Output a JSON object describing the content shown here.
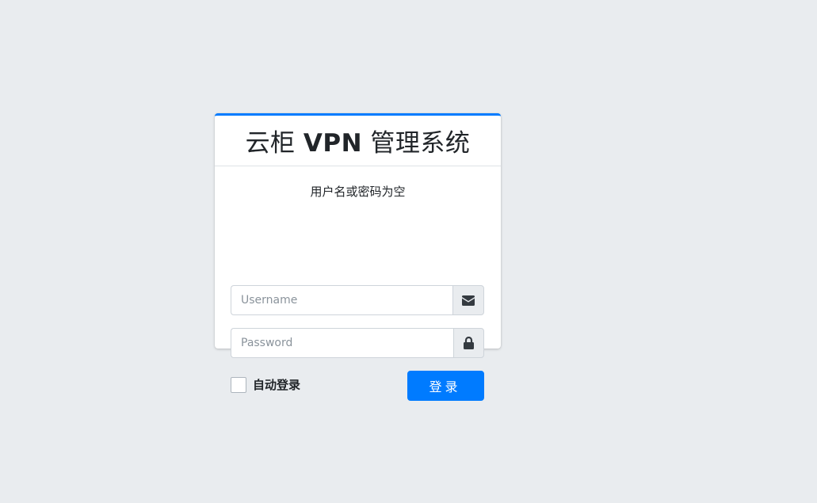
{
  "header": {
    "brand_prefix": "云柜 ",
    "brand_bold": "VPN",
    "brand_suffix": " 管理系统"
  },
  "body": {
    "message": "用户名或密码为空"
  },
  "form": {
    "username_placeholder": "Username",
    "username_value": "",
    "password_placeholder": "Password",
    "password_value": "",
    "remember_label": "自动登录",
    "remember_checked": false,
    "submit_label": "登录"
  },
  "icons": {
    "username_icon": "envelope-icon",
    "password_icon": "lock-icon"
  },
  "colors": {
    "page_background": "#e9ecef",
    "accent": "#007bff",
    "icon": "#343a40"
  }
}
